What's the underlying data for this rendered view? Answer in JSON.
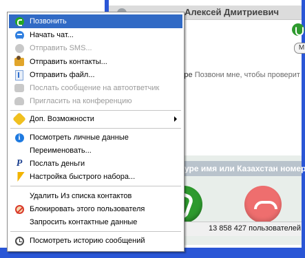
{
  "background": {
    "contact_name": "Алексей Дмитриевич",
    "mood_prefix": "уре",
    "mood_text": "Позвони мне, чтобы проверит",
    "promo_text": "уре имя или Казахстан номер...",
    "users_online": "13 858 427 пользователей",
    "pill_label": "M"
  },
  "menu": {
    "items": [
      {
        "label": "Позвонить",
        "icon": "phone-icon",
        "state": "selected"
      },
      {
        "label": "Начать чат...",
        "icon": "chat-icon",
        "state": "enabled"
      },
      {
        "label": "Отправить SMS...",
        "icon": "sms-icon",
        "state": "disabled"
      },
      {
        "label": "Отправить контакты...",
        "icon": "contacts-icon",
        "state": "enabled"
      },
      {
        "label": "Отправить файл...",
        "icon": "file-icon",
        "state": "enabled"
      },
      {
        "label": "Послать сообщение на автоответчик",
        "icon": "voicemail-icon",
        "state": "disabled"
      },
      {
        "label": "Пригласить на конференцию",
        "icon": "conference-icon",
        "state": "disabled"
      },
      {
        "label": "Доп. Возможности",
        "icon": "extras-icon",
        "state": "submenu"
      },
      {
        "label": "Посмотреть личные данные",
        "icon": "info-icon",
        "state": "enabled"
      },
      {
        "label": "Переименовать...",
        "icon": "",
        "state": "enabled"
      },
      {
        "label": "Послать деньги",
        "icon": "paypal-icon",
        "state": "enabled"
      },
      {
        "label": "Настройка быстрого набора...",
        "icon": "speed-dial-icon",
        "state": "enabled"
      },
      {
        "label": "Удалить Из списка контактов",
        "icon": "",
        "state": "enabled"
      },
      {
        "label": "Блокировать этого пользователя",
        "icon": "block-icon",
        "state": "enabled"
      },
      {
        "label": "Запросить контактные данные",
        "icon": "",
        "state": "enabled"
      },
      {
        "label": "Посмотреть историю сообщений",
        "icon": "history-icon",
        "state": "enabled"
      }
    ]
  },
  "colors": {
    "selection": "#316ac5",
    "window_border": "#2a56d6",
    "call_green": "#2e9a2e",
    "hangup_red": "#ee6e6e"
  }
}
